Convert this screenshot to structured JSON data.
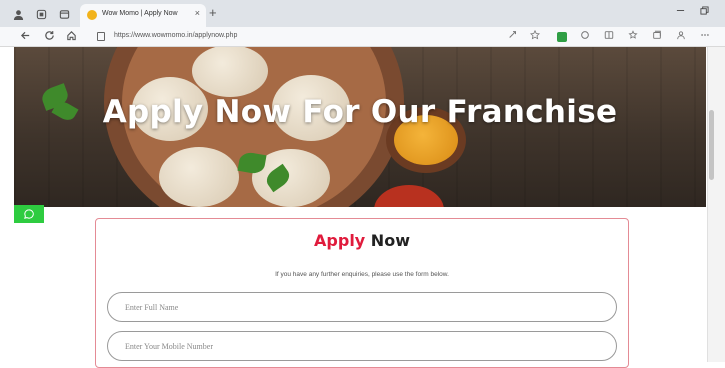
{
  "browser": {
    "tab_title": "Wow Momo | Apply Now",
    "url": "https://www.wowmomo.in/applynow.php",
    "new_tab_label": "+",
    "tab_close_label": "×"
  },
  "hero": {
    "title": "Apply Now For Our Franchise"
  },
  "form": {
    "title_accent": "Apply",
    "title_rest": " Now",
    "subtitle": "If you have any further enquiries, please use the form below.",
    "full_name_placeholder": "Enter Full Name",
    "mobile_placeholder": "Enter Your Mobile Number"
  },
  "colors": {
    "accent": "#e01b3c",
    "whatsapp": "#2ecc40",
    "card_border": "#e48b95"
  }
}
